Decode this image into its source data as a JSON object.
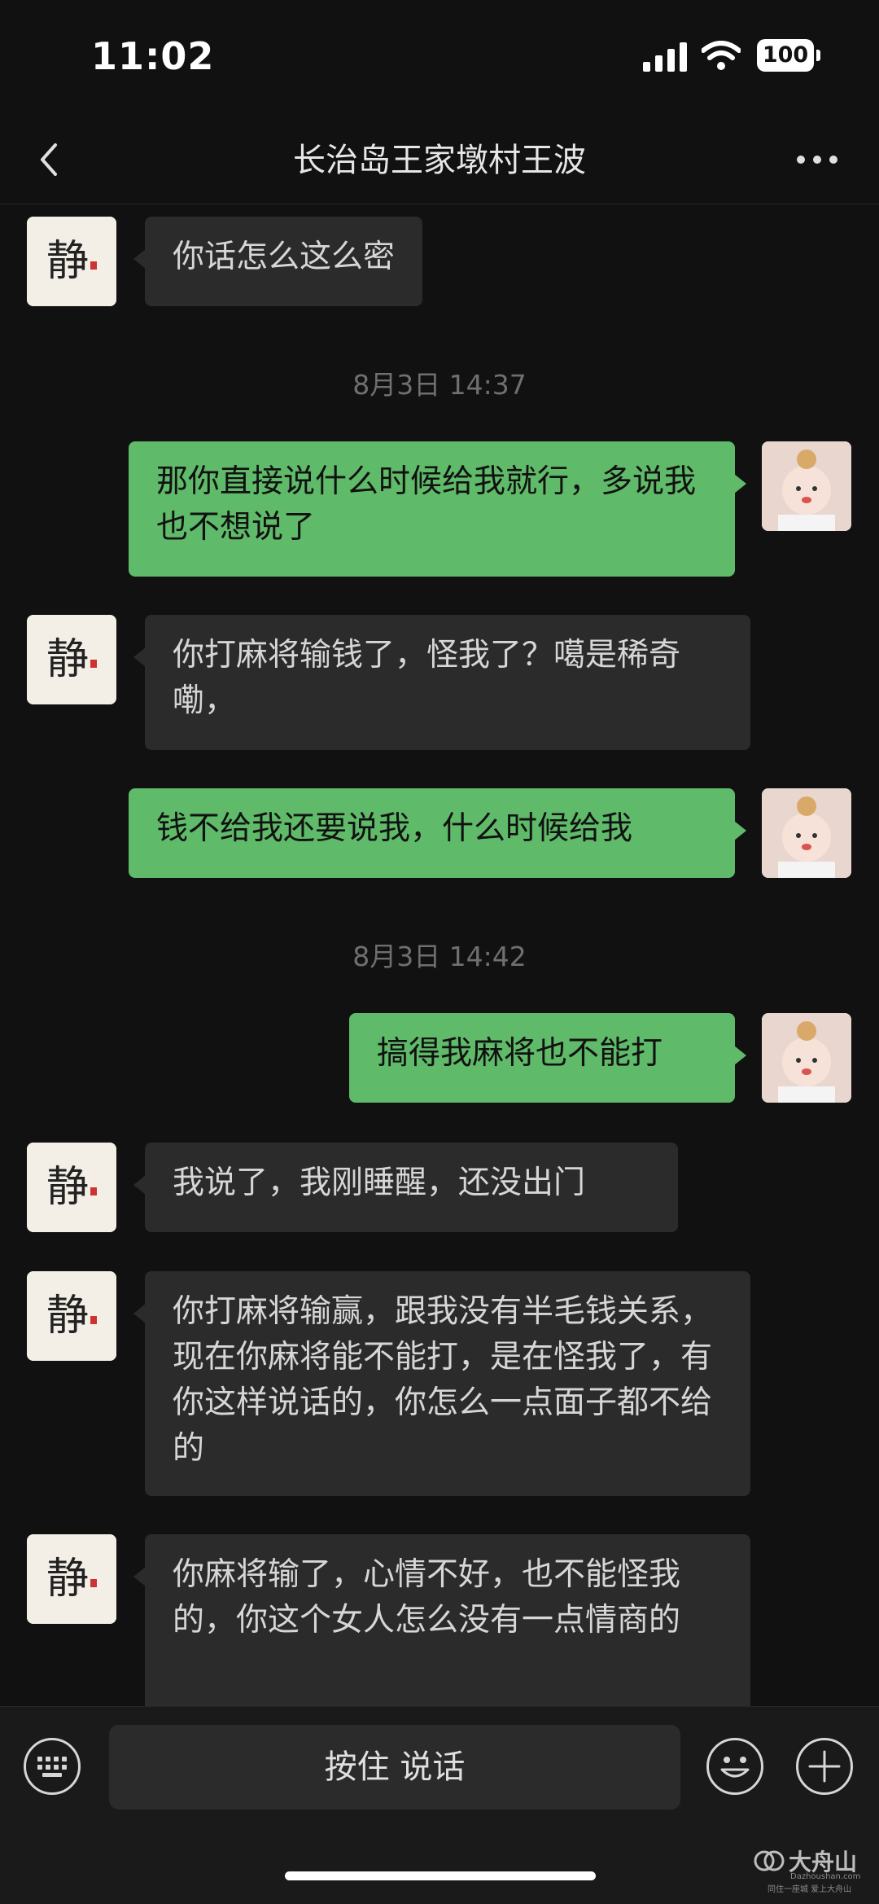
{
  "status_bar": {
    "time": "11:02",
    "battery": "100"
  },
  "header": {
    "title": "长治岛王家墩村王波"
  },
  "messages": [
    {
      "side": "in",
      "text": "你话怎么这么密"
    },
    {
      "time": "8月3日 14:37"
    },
    {
      "side": "out",
      "text": "那你直接说什么时候给我就行，多说我也不想说了"
    },
    {
      "side": "in",
      "text": "你打麻将输钱了，怪我了？噶是稀奇嘞，"
    },
    {
      "side": "out",
      "text": "钱不给我还要说我，什么时候给我"
    },
    {
      "time": "8月3日 14:42"
    },
    {
      "side": "out",
      "text": "搞得我麻将也不能打"
    },
    {
      "side": "in",
      "text": "我说了，我刚睡醒，还没出门"
    },
    {
      "side": "in",
      "text": "你打麻将输赢，跟我没有半毛钱关系，现在你麻将能不能打，是在怪我了，有你这样说话的，你怎么一点面子都不给的"
    },
    {
      "side": "in",
      "text": "你麻将输了，心情不好，也不能怪我的，你这个女人怎么没有一点情商的"
    }
  ],
  "input_bar": {
    "voice_label": "按住 说话"
  },
  "watermark": {
    "brand": "大舟山",
    "url": "Dazhoushan.com",
    "slogan": "同住一座城 爱上大舟山"
  },
  "colors": {
    "background": "#111111",
    "bubble_in": "#2b2b2b",
    "bubble_out": "#5fba69"
  }
}
